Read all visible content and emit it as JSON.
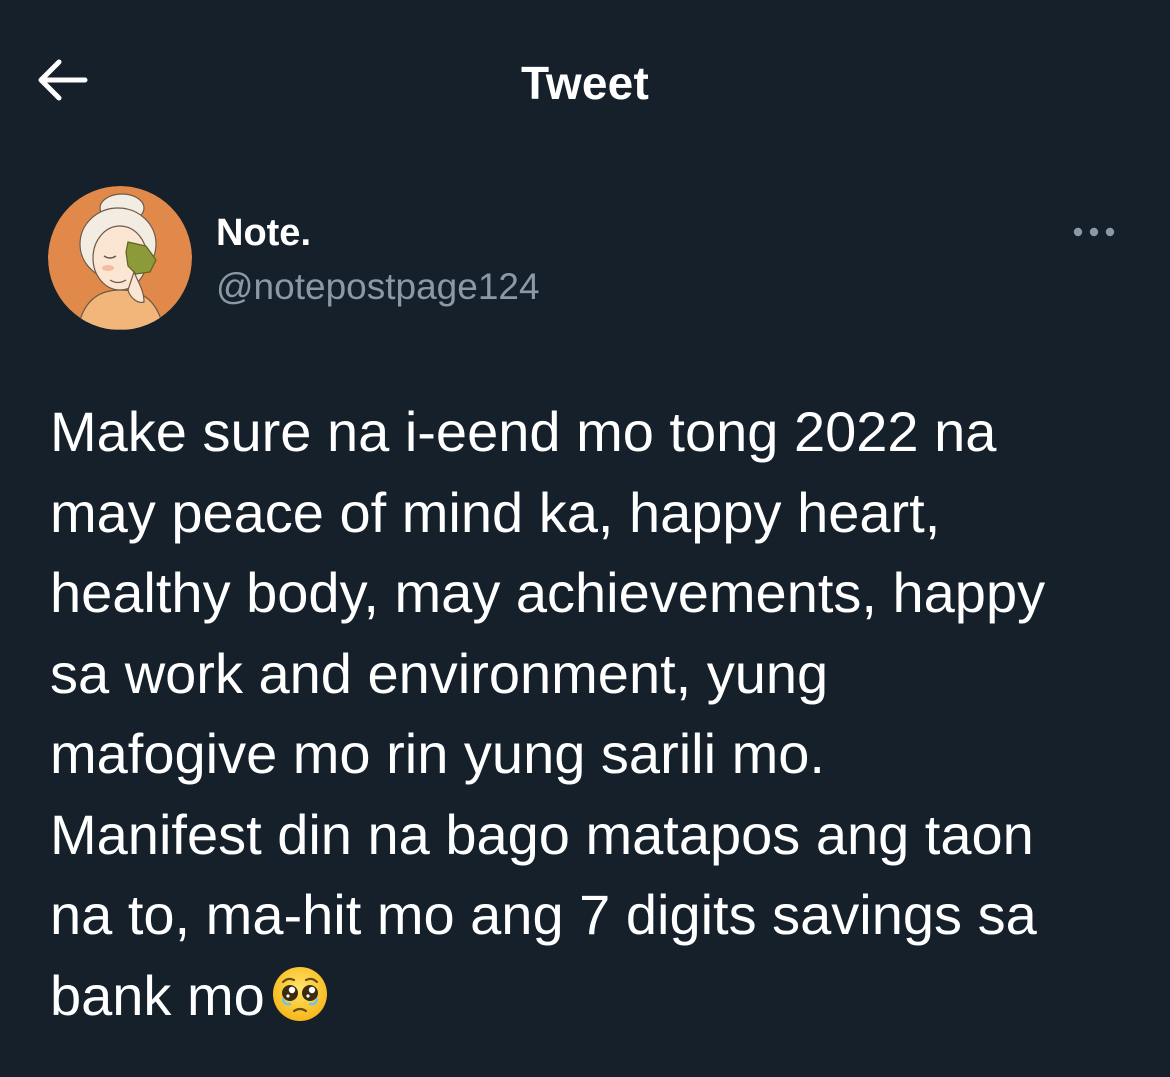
{
  "header": {
    "title": "Tweet",
    "back_icon": "arrow-left-icon"
  },
  "author": {
    "display_name": "Note.",
    "handle": "@notepostpage124",
    "avatar_icon": "avatar-illustration"
  },
  "menu": {
    "icon": "more-horizontal-icon"
  },
  "tweet": {
    "text": "Make sure na i-eend mo tong 2022 na\nmay peace of mind ka, happy heart,\nhealthy body, may achievements, happy\nsa work and environment, yung\nmafogive mo rin yung sarili mo.\nManifest din na bago matapos ang taon\nna to, ma-hit mo ang 7 digits savings sa\nbank mo",
    "emoji": "pleading-face-emoji"
  },
  "colors": {
    "background": "#15202b",
    "text_primary": "#ffffff",
    "text_secondary": "#8b98a5",
    "avatar_bg": "#e0894a"
  }
}
